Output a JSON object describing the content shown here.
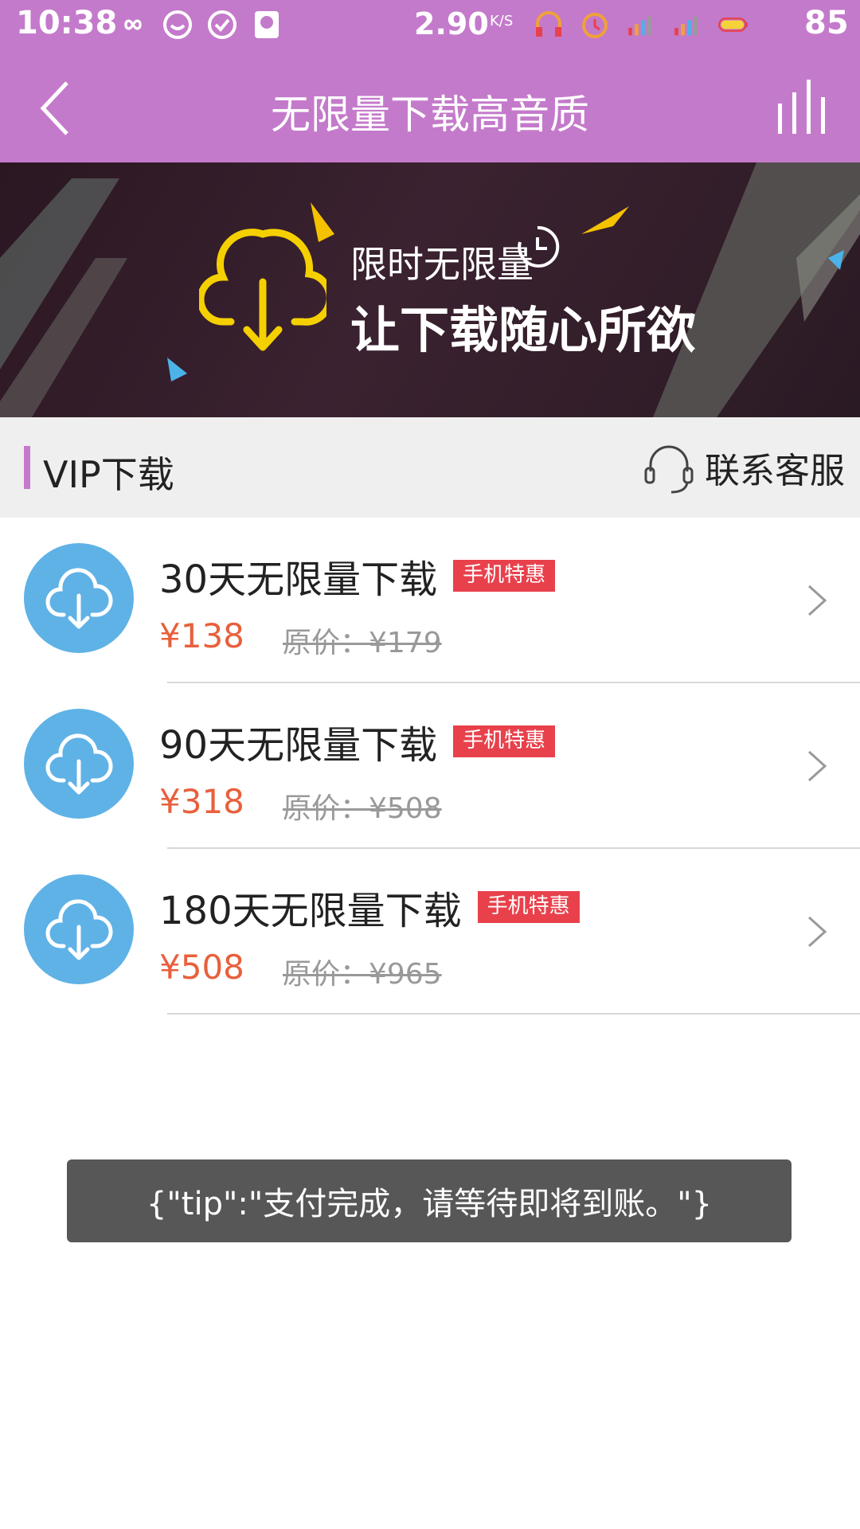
{
  "status_bar": {
    "time": "10:38",
    "net_speed": "2.90",
    "net_unit": "K/S",
    "battery": "85"
  },
  "navbar": {
    "title": "无限量下载高音质"
  },
  "banner": {
    "line1": "限时无限量",
    "line2": "让下载随心所欲"
  },
  "section": {
    "title": "VIP下载",
    "customer_service": "联系客服"
  },
  "plans": [
    {
      "title": "30天无限量下载",
      "badge": "手机特惠",
      "price": "¥138",
      "original": "原价：¥179"
    },
    {
      "title": "90天无限量下载",
      "badge": "手机特惠",
      "price": "¥318",
      "original": "原价：¥508"
    },
    {
      "title": "180天无限量下载",
      "badge": "手机特惠",
      "price": "¥508",
      "original": "原价：¥965"
    }
  ],
  "toast": {
    "text": "{\"tip\":\"支付完成，请等待即将到账。\"}"
  },
  "colors": {
    "header": "#c47acb",
    "accent_blue": "#5fb2e6",
    "price": "#e8603c",
    "badge": "#e8414c"
  }
}
